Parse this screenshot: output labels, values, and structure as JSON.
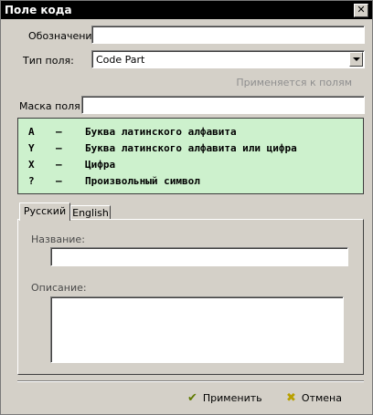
{
  "window": {
    "title": "Поле кода",
    "close_glyph": "✕"
  },
  "form": {
    "designation_label": "Обозначение:",
    "designation_value": "",
    "field_type_label": "Тип поля:",
    "field_type_value": "Code Part",
    "applies_to_fields": "Применяется к полям",
    "mask_label": "Маска поля:",
    "mask_value": ""
  },
  "mask_legend": [
    {
      "key": "A",
      "dash": "–",
      "text": "Буква латинского алфавита"
    },
    {
      "key": "Y",
      "dash": "–",
      "text": "Буква латинского алфавита или цифра"
    },
    {
      "key": "X",
      "dash": "–",
      "text": "Цифра"
    },
    {
      "key": "?",
      "dash": "–",
      "text": "Произвольный символ"
    }
  ],
  "tabs": [
    {
      "label": "Русский",
      "active": true
    },
    {
      "label": "English",
      "active": false
    }
  ],
  "tab_content": {
    "name_label": "Название:",
    "name_value": "",
    "description_label": "Описание:",
    "description_value": ""
  },
  "buttons": {
    "apply": {
      "label": "Применить",
      "icon": "check-icon",
      "color": "#5f7a00"
    },
    "cancel": {
      "label": "Отмена",
      "icon": "cross-icon",
      "color": "#b8a000"
    }
  },
  "colors": {
    "mask_bg": "#cdf1cd",
    "titlebar": "#000000",
    "window": "#d4d0c8"
  }
}
